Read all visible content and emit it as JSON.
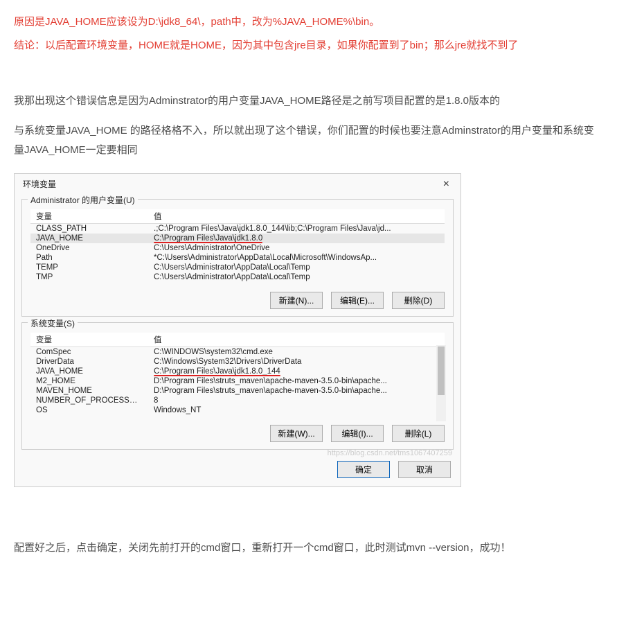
{
  "article": {
    "red1": "原因是JAVA_HOME应该设为D:\\jdk8_64\\，path中，改为%JAVA_HOME%\\bin。",
    "red2": "结论：以后配置环境变量，HOME就是HOME，因为其中包含jre目录，如果你配置到了bin；那么jre就找不到了",
    "para1": "我那出现这个错误信息是因为Adminstrator的用户变量JAVA_HOME路径是之前写项目配置的是1.8.0版本的",
    "para2": "与系统变量JAVA_HOME 的路径格格不入，所以就出现了这个错误，你们配置的时候也要注意Adminstrator的用户变量和系统变量JAVA_HOME一定要相同",
    "para3": "配置好之后，点击确定，关闭先前打开的cmd窗口，重新打开一个cmd窗口，此时测试mvn --version，成功！"
  },
  "dialog": {
    "title": "环境变量",
    "user_group_label": "Administrator 的用户变量(U)",
    "sys_group_label": "系统变量(S)",
    "col_var": "变量",
    "col_val": "值",
    "user_rows": [
      {
        "name": "CLASS_PATH",
        "value": ".;C:\\Program Files\\Java\\jdk1.8.0_144\\lib;C:\\Program Files\\Java\\jd..."
      },
      {
        "name": "JAVA_HOME",
        "value": "C:\\Program Files\\Java\\jdk1.8.0"
      },
      {
        "name": "OneDrive",
        "value": "C:\\Users\\Administrator\\OneDrive"
      },
      {
        "name": "Path",
        "value": "*C:\\Users\\Administrator\\AppData\\Local\\Microsoft\\WindowsAp..."
      },
      {
        "name": "TEMP",
        "value": "C:\\Users\\Administrator\\AppData\\Local\\Temp"
      },
      {
        "name": "TMP",
        "value": "C:\\Users\\Administrator\\AppData\\Local\\Temp"
      }
    ],
    "sys_rows": [
      {
        "name": "ComSpec",
        "value": "C:\\WINDOWS\\system32\\cmd.exe"
      },
      {
        "name": "DriverData",
        "value": "C:\\Windows\\System32\\Drivers\\DriverData"
      },
      {
        "name": "JAVA_HOME",
        "value": "C:\\Program Files\\Java\\jdk1.8.0_144"
      },
      {
        "name": "M2_HOME",
        "value": "D:\\Program Files\\struts_maven\\apache-maven-3.5.0-bin\\apache..."
      },
      {
        "name": "MAVEN_HOME",
        "value": "D:\\Program Files\\struts_maven\\apache-maven-3.5.0-bin\\apache..."
      },
      {
        "name": "NUMBER_OF_PROCESSORS",
        "value": "8"
      },
      {
        "name": "OS",
        "value": "Windows_NT"
      }
    ],
    "user_btns": {
      "new": "新建(N)...",
      "edit": "编辑(E)...",
      "del": "删除(D)"
    },
    "sys_btns": {
      "new": "新建(W)...",
      "edit": "编辑(I)...",
      "del": "删除(L)"
    },
    "ok": "确定",
    "cancel": "取消",
    "watermark": "https://blog.csdn.net/tms1067407259"
  }
}
